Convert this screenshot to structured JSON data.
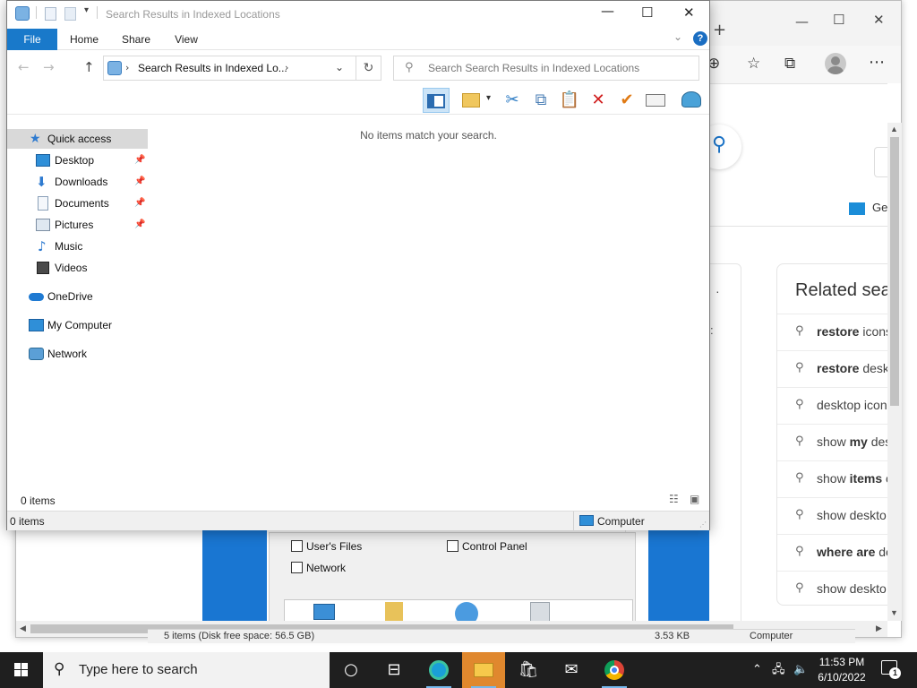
{
  "explorer": {
    "title": "Search Results in Indexed Locations",
    "ribbon_tabs": [
      "File",
      "Home",
      "Share",
      "View"
    ],
    "help": "?",
    "breadcrumb": "Search Results in Indexed Lo...",
    "search_placeholder": "Search Search Results in Indexed Locations",
    "empty_message": "No items match your search.",
    "items_count": "0 items",
    "status_left": "0 items",
    "status_zone": "Computer",
    "nav": {
      "quick_access": "Quick access",
      "items": [
        {
          "label": "Desktop",
          "icon": "desktop-icon",
          "pinned": true
        },
        {
          "label": "Downloads",
          "icon": "downloads-icon",
          "pinned": true
        },
        {
          "label": "Documents",
          "icon": "documents-icon",
          "pinned": true
        },
        {
          "label": "Pictures",
          "icon": "pictures-icon",
          "pinned": true
        },
        {
          "label": "Music",
          "icon": "music-icon",
          "pinned": false
        },
        {
          "label": "Videos",
          "icon": "videos-icon",
          "pinned": false
        }
      ],
      "onedrive": "OneDrive",
      "my_computer": "My Computer",
      "network": "Network"
    }
  },
  "browser": {
    "ge_text": "Ge",
    "related_title": "Related sea",
    "related": [
      {
        "bold": "restore",
        "rest": " icons"
      },
      {
        "bold": "restore",
        "rest": " desk"
      },
      {
        "bold": "",
        "rest": "desktop icon"
      },
      {
        "bold": "my",
        "pre": "show ",
        "rest": " des"
      },
      {
        "bold": "items",
        "pre": "show ",
        "rest": " o"
      },
      {
        "bold": "",
        "rest": "show deskto"
      },
      {
        "bold": "where are",
        "rest": " de"
      },
      {
        "bold": "",
        "rest": "show deskto"
      }
    ],
    "dialog": {
      "user_files": "User's Files",
      "control_panel": "Control Panel",
      "network": "Network"
    },
    "status_left": "5 items (Disk free space: 56.5 GB)",
    "status_mid": "3.53 KB",
    "status_right": "Computer"
  },
  "taskbar": {
    "search_text": "Type here to search",
    "time": "11:53 PM",
    "date": "6/10/2022",
    "notification_count": "1"
  },
  "colors": {
    "accent": "#1979ca",
    "taskbar": "#1f1f1f",
    "active_app": "#e0882e"
  }
}
